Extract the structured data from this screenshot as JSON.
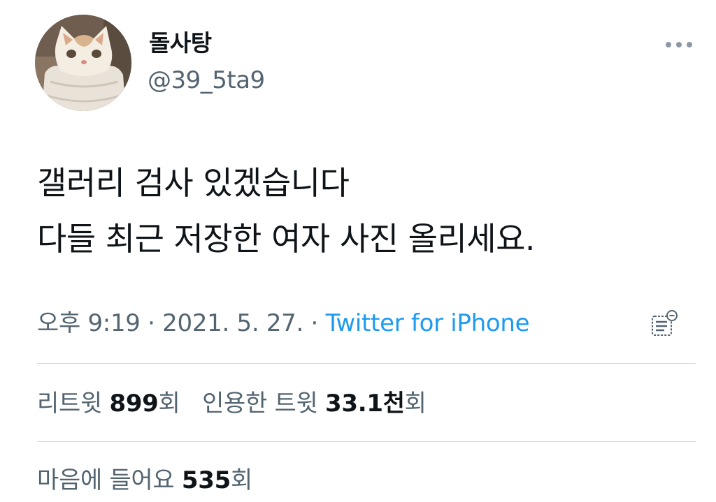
{
  "user": {
    "display_name": "돌사탕",
    "handle": "@39_5ta9",
    "avatar_icon": "cat-avatar"
  },
  "more_icon": "more-horizontal-icon",
  "tweet": {
    "lines": [
      "갤러리 검사 있겠습니다",
      "다들 최근 저장한 여자 사진 올리세요."
    ]
  },
  "meta": {
    "time": "오후 9:19",
    "separator": " · ",
    "date": "2021. 5. 27.",
    "source": "Twitter for iPhone",
    "analytics_icon": "analytics-icon"
  },
  "stats": {
    "retweets_label": "리트윗",
    "retweets_count": "899",
    "retweets_suffix": "회",
    "quotes_label": "인용한 트윗",
    "quotes_count": "33.1천",
    "quotes_suffix": "회",
    "likes_label": "마음에 들어요",
    "likes_count": "535",
    "likes_suffix": "회"
  },
  "colors": {
    "text_primary": "#0f1419",
    "text_secondary": "#536471",
    "link": "#1d9bf0",
    "divider": "#cfd9de"
  }
}
